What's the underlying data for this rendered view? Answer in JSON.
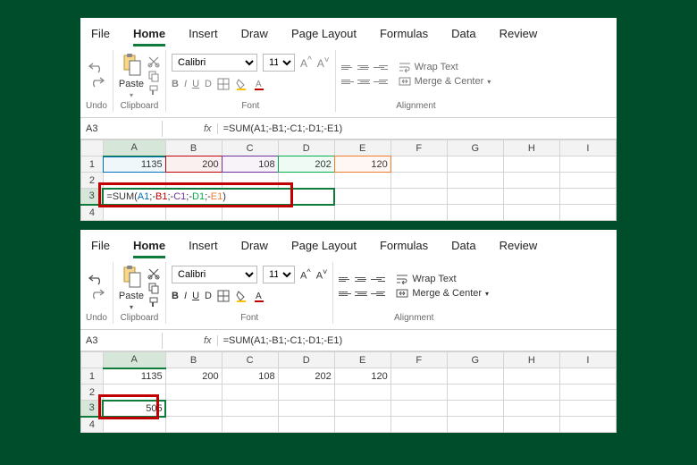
{
  "menu": {
    "file": "File",
    "home": "Home",
    "insert": "Insert",
    "draw": "Draw",
    "page_layout": "Page Layout",
    "formulas": "Formulas",
    "data": "Data",
    "review": "Review"
  },
  "groups": {
    "undo": "Undo",
    "clipboard": "Clipboard",
    "font": "Font",
    "alignment": "Alignment"
  },
  "clipboard": {
    "paste": "Paste"
  },
  "font": {
    "name": "Calibri",
    "size": "11",
    "bold": "B",
    "italic": "I",
    "underline": "U",
    "strike": "D",
    "increase": "A^",
    "decrease": "A˅"
  },
  "alignment": {
    "wrap": "Wrap Text",
    "merge": "Merge & Center"
  },
  "top": {
    "name_box": "A3",
    "fx_label": "fx",
    "fx_value": "=SUM(A1;-B1;-C1;-D1;-E1)",
    "cols": [
      "A",
      "B",
      "C",
      "D",
      "E",
      "F",
      "G",
      "H",
      "I"
    ],
    "row1": {
      "a": "1135",
      "b": "200",
      "c": "108",
      "d": "202",
      "e": "120"
    },
    "a3_formula": {
      "pre": "=SUM(",
      "a": "A1",
      "b": "B1",
      "c": "C1",
      "d": "D1",
      "e": "E1",
      "sep": ";-",
      "post": ")"
    }
  },
  "bottom": {
    "name_box": "A3",
    "fx_label": "fx",
    "fx_value": "=SUM(A1;-B1;-C1;-D1;-E1)",
    "cols": [
      "A",
      "B",
      "C",
      "D",
      "E",
      "F",
      "G",
      "H",
      "I"
    ],
    "row1": {
      "a": "1135",
      "b": "200",
      "c": "108",
      "d": "202",
      "e": "120"
    },
    "a3_result": "505"
  }
}
